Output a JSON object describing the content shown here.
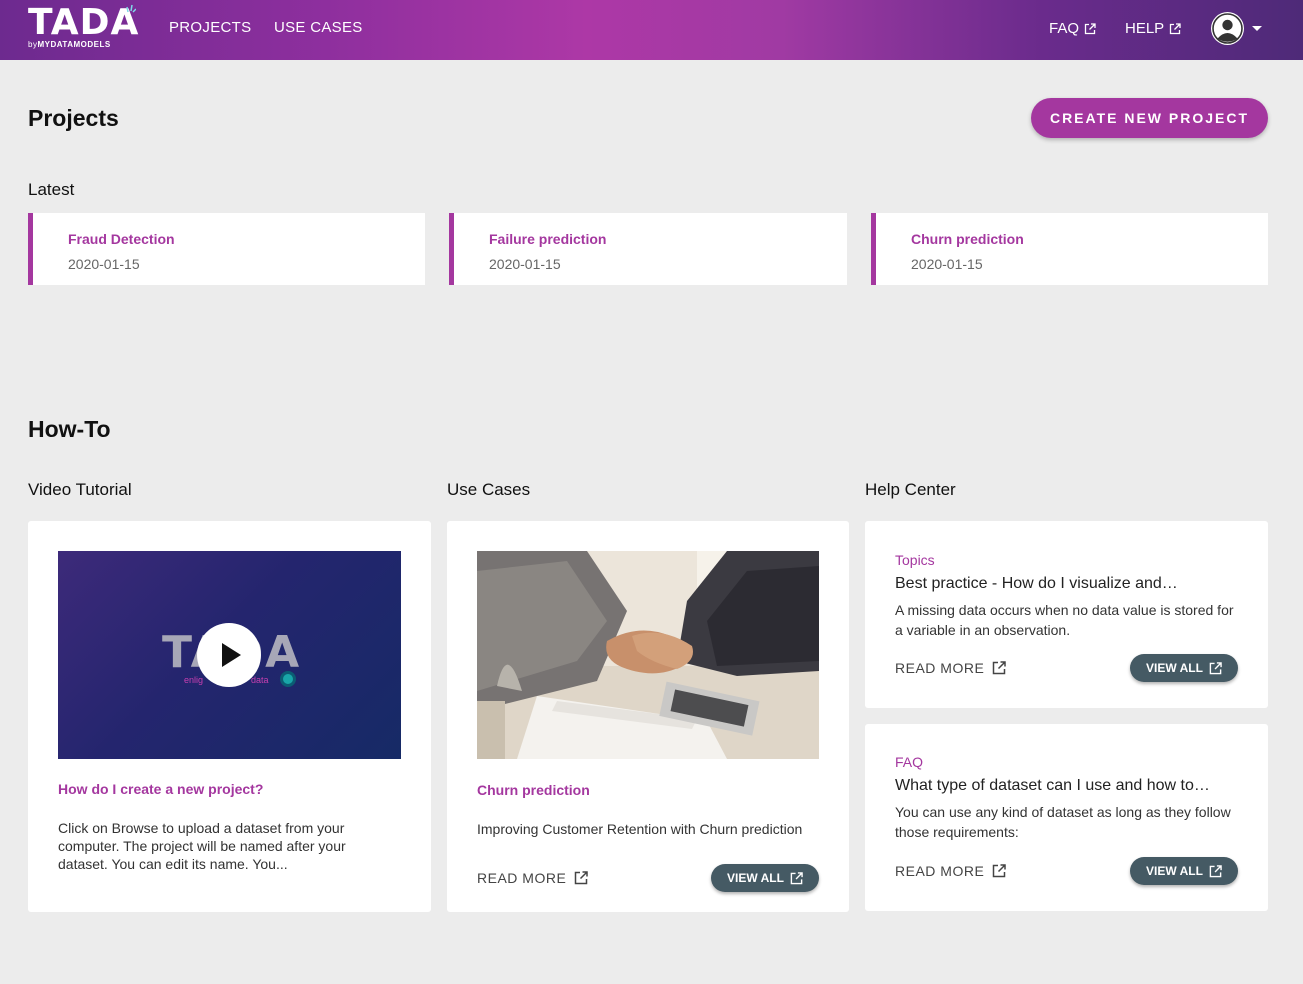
{
  "header": {
    "logo_text": "TADA",
    "logo_by": "by",
    "logo_brand": "MYDATAMODELS",
    "nav": [
      {
        "label": "PROJECTS"
      },
      {
        "label": "USE CASES"
      }
    ],
    "faq_label": "FAQ",
    "help_label": "HELP"
  },
  "projects": {
    "title": "Projects",
    "create_label": "CREATE NEW PROJECT",
    "latest_label": "Latest",
    "items": [
      {
        "name": "Fraud Detection",
        "date": "2020-01-15"
      },
      {
        "name": "Failure prediction",
        "date": "2020-01-15"
      },
      {
        "name": "Churn prediction",
        "date": "2020-01-15"
      }
    ]
  },
  "howto": {
    "title": "How-To",
    "video": {
      "heading": "Video Tutorial",
      "thumb_text": "TADA",
      "thumb_sub_left": "enlig",
      "thumb_sub_right": "data",
      "title": "How do I create a new project?",
      "text": "Click on Browse to upload a dataset from your computer. The project will be named after your dataset. You can edit its name. You..."
    },
    "use_cases": {
      "heading": "Use Cases",
      "title": "Churn prediction",
      "text": "Improving Customer Retention with Churn prediction",
      "read_more": "READ MORE",
      "view_all": "VIEW ALL"
    },
    "help_center": {
      "heading": "Help Center",
      "topics": {
        "label": "Topics",
        "title": "Best practice - How do I visualize and…",
        "text": "A missing data occurs when no data value is stored for a variable in an observation.",
        "read_more": "READ MORE",
        "view_all": "VIEW ALL"
      },
      "faq": {
        "label": "FAQ",
        "title": "What type of dataset can I use and how to…",
        "text": "You can use any kind of dataset as long as they follow those requirements:",
        "read_more": "READ MORE",
        "view_all": "VIEW ALL"
      }
    }
  },
  "colors": {
    "accent": "#a4379f",
    "dark_button": "#455a64",
    "background": "#ececec"
  }
}
